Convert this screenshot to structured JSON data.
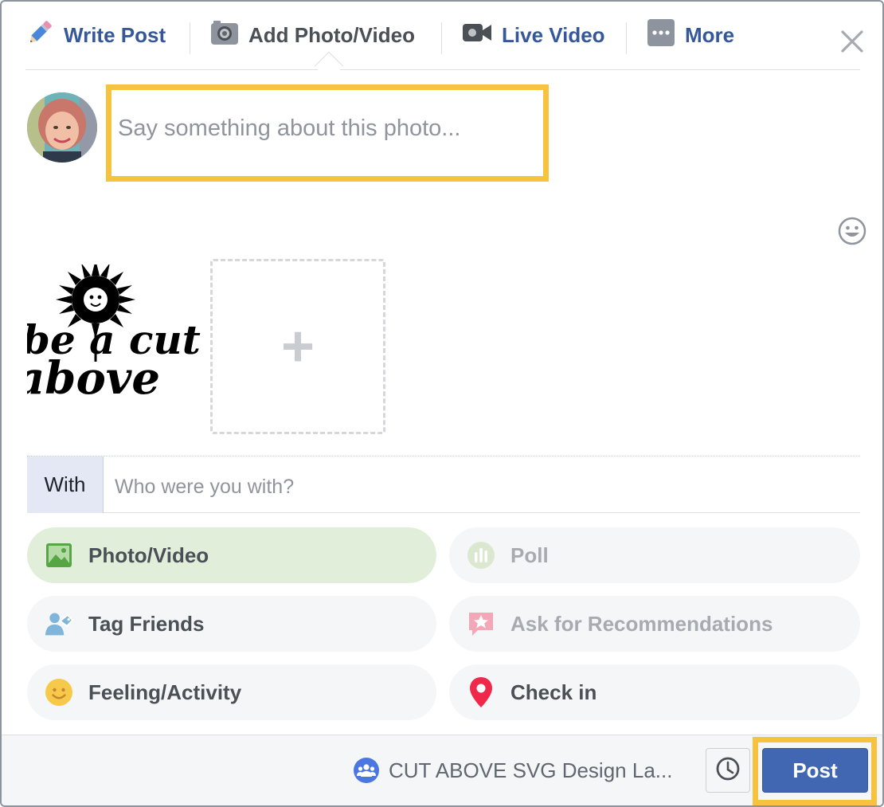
{
  "tabs": [
    {
      "label": "Write Post",
      "icon": "pencil-icon"
    },
    {
      "label": "Add Photo/Video",
      "icon": "camera-icon"
    },
    {
      "label": "Live Video",
      "icon": "video-camera-icon"
    },
    {
      "label": "More",
      "icon": "more-dots-icon"
    }
  ],
  "composer": {
    "placeholder": "Say something about this photo...",
    "highlight_color": "#f7c23d"
  },
  "attached_image": {
    "text_line1": "be a cut",
    "text_line2": "above"
  },
  "add_photo": {
    "symbol": "+"
  },
  "with": {
    "label": "With",
    "placeholder": "Who were you with?"
  },
  "actions": [
    {
      "label": "Photo/Video",
      "icon": "photo-icon",
      "state": "selected"
    },
    {
      "label": "Poll",
      "icon": "poll-icon",
      "state": "disabled"
    },
    {
      "label": "Tag Friends",
      "icon": "tag-friends-icon",
      "state": "normal"
    },
    {
      "label": "Ask for Recommendations",
      "icon": "recommendations-icon",
      "state": "disabled"
    },
    {
      "label": "Feeling/Activity",
      "icon": "feeling-icon",
      "state": "normal"
    },
    {
      "label": "Check in",
      "icon": "location-pin-icon",
      "state": "normal"
    }
  ],
  "footer": {
    "audience": "CUT ABOVE SVG Design La...",
    "audience_icon": "group-icon",
    "schedule_icon": "clock-icon",
    "post_label": "Post"
  },
  "colors": {
    "link_blue": "#365899",
    "button_blue": "#4267b2",
    "highlight": "#f7c23d",
    "selected_pill": "#e1efda"
  }
}
